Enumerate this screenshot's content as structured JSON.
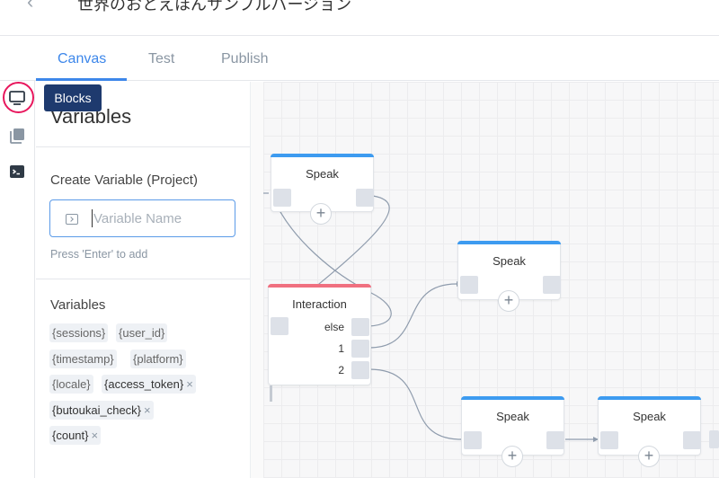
{
  "header": {
    "back_icon": "chevron-left-icon",
    "project_title": "世界のおとえほんサンプルバージョン"
  },
  "tabs": [
    {
      "label": "Canvas",
      "active": true
    },
    {
      "label": "Test",
      "active": false
    },
    {
      "label": "Publish",
      "active": false
    }
  ],
  "sidebar": {
    "icons": [
      "monitor-icon",
      "book-icon",
      "terminal-icon"
    ],
    "tooltip": "Blocks"
  },
  "panel": {
    "title": "Variables",
    "create_label": "Create Variable (Project)",
    "input_placeholder": "Variable Name",
    "hint": "Press 'Enter' to add",
    "variables_label": "Variables",
    "variables": [
      {
        "name": "{sessions}",
        "removable": false
      },
      {
        "name": "{user_id}",
        "removable": false
      },
      {
        "name": "{timestamp}",
        "removable": false
      },
      {
        "name": "{platform}",
        "removable": false
      },
      {
        "name": "{locale}",
        "removable": false
      },
      {
        "name": "{access_token}",
        "removable": true
      },
      {
        "name": "{butoukai_check}",
        "removable": true
      },
      {
        "name": "{count}",
        "removable": true
      }
    ],
    "remove_glyph": "×"
  },
  "canvas": {
    "blocks": [
      {
        "title": "Speak",
        "color": "#3d9bf0"
      },
      {
        "title": "Interaction",
        "color": "#f07080",
        "choices": [
          "else",
          "1",
          "2"
        ]
      },
      {
        "title": "Speak",
        "color": "#3d9bf0"
      },
      {
        "title": "Speak",
        "color": "#3d9bf0"
      },
      {
        "title": "Speak",
        "color": "#3d9bf0"
      }
    ],
    "add_glyph": "+"
  },
  "colors": {
    "accent": "#3d87ea",
    "tooltip_bg": "#1e3a6e",
    "highlight": "#e8175d",
    "speak": "#3d9bf0",
    "interaction": "#f07080"
  }
}
